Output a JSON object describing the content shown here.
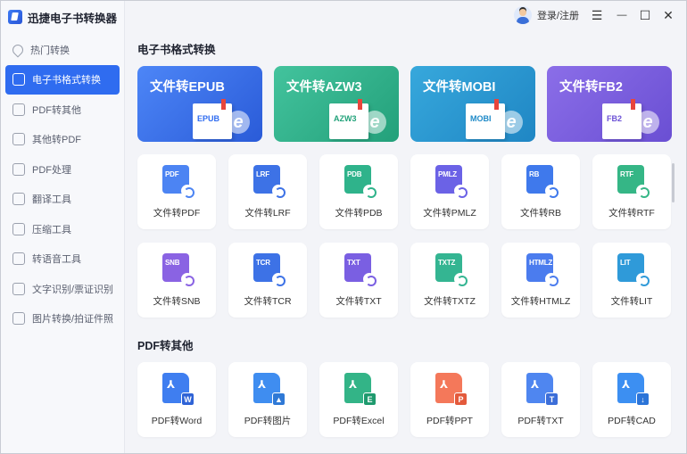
{
  "app": {
    "name": "迅捷电子书转换器"
  },
  "header": {
    "login_label": "登录/注册",
    "menu_icon": "☰",
    "minimize_icon": "—",
    "maximize_icon": "☐",
    "close_icon": "✕"
  },
  "sidebar": {
    "items": [
      {
        "label": "热门转换",
        "active": false
      },
      {
        "label": "电子书格式转换",
        "active": true
      },
      {
        "label": "PDF转其他",
        "active": false
      },
      {
        "label": "其他转PDF",
        "active": false
      },
      {
        "label": "PDF处理",
        "active": false
      },
      {
        "label": "翻译工具",
        "active": false
      },
      {
        "label": "压缩工具",
        "active": false
      },
      {
        "label": "转语音工具",
        "active": false
      },
      {
        "label": "文字识别/票证识别",
        "active": false
      },
      {
        "label": "图片转换/拍证件照",
        "active": false
      }
    ]
  },
  "ebook_section": {
    "title": "电子书格式转换",
    "banners": [
      {
        "title": "文件转EPUB",
        "tag": "EPUB",
        "from": "#4d86f7",
        "to": "#2a5bd8",
        "accent": "#2f6cf0"
      },
      {
        "title": "文件转AZW3",
        "tag": "AZW3",
        "from": "#43c39d",
        "to": "#23a07a",
        "accent": "#22a27a"
      },
      {
        "title": "文件转MOBI",
        "tag": "MOBI",
        "from": "#37a8dc",
        "to": "#1f86c4",
        "accent": "#1f8ac8"
      },
      {
        "title": "文件转FB2",
        "tag": "FB2",
        "from": "#8b6ee8",
        "to": "#6a4fd3",
        "accent": "#6c52d6"
      }
    ],
    "row1": [
      {
        "tag": "PDF",
        "label": "文件转PDF",
        "color": "#4c84f3"
      },
      {
        "tag": "LRF",
        "label": "文件转LRF",
        "color": "#3d72e6"
      },
      {
        "tag": "PDB",
        "label": "文件转PDB",
        "color": "#2fb38b"
      },
      {
        "tag": "PMLZ",
        "label": "文件转PMLZ",
        "color": "#6b62e6"
      },
      {
        "tag": "RB",
        "label": "文件转RB",
        "color": "#3f79ec"
      },
      {
        "tag": "RTF",
        "label": "文件转RTF",
        "color": "#35b686"
      }
    ],
    "row2": [
      {
        "tag": "SNB",
        "label": "文件转SNB",
        "color": "#8a63e3"
      },
      {
        "tag": "TCR",
        "label": "文件转TCR",
        "color": "#3d72e6"
      },
      {
        "tag": "TXT",
        "label": "文件转TXT",
        "color": "#7a5fe2"
      },
      {
        "tag": "TXTZ",
        "label": "文件转TXTZ",
        "color": "#34b592"
      },
      {
        "tag": "HTMLZ",
        "label": "文件转HTMLZ",
        "color": "#4b7cee"
      },
      {
        "tag": "LIT",
        "label": "文件转LIT",
        "color": "#2f9ad9"
      }
    ]
  },
  "pdf_section": {
    "title": "PDF转其他",
    "items": [
      {
        "label": "PDF转Word",
        "sub": "W",
        "color": "#3f7ef0",
        "sub_color": "#2f63d6"
      },
      {
        "label": "PDF转图片",
        "sub": "▲",
        "color": "#3f8df0",
        "sub_color": "#2f79d6"
      },
      {
        "label": "PDF转Excel",
        "sub": "E",
        "color": "#33b487",
        "sub_color": "#1f9a6e"
      },
      {
        "label": "PDF转PPT",
        "sub": "P",
        "color": "#f4785a",
        "sub_color": "#e35a3c"
      },
      {
        "label": "PDF转TXT",
        "sub": "T",
        "color": "#4f86f0",
        "sub_color": "#3c6ed8"
      },
      {
        "label": "PDF转CAD",
        "sub": "↓",
        "color": "#3c8ff2",
        "sub_color": "#2b74d8"
      }
    ]
  }
}
